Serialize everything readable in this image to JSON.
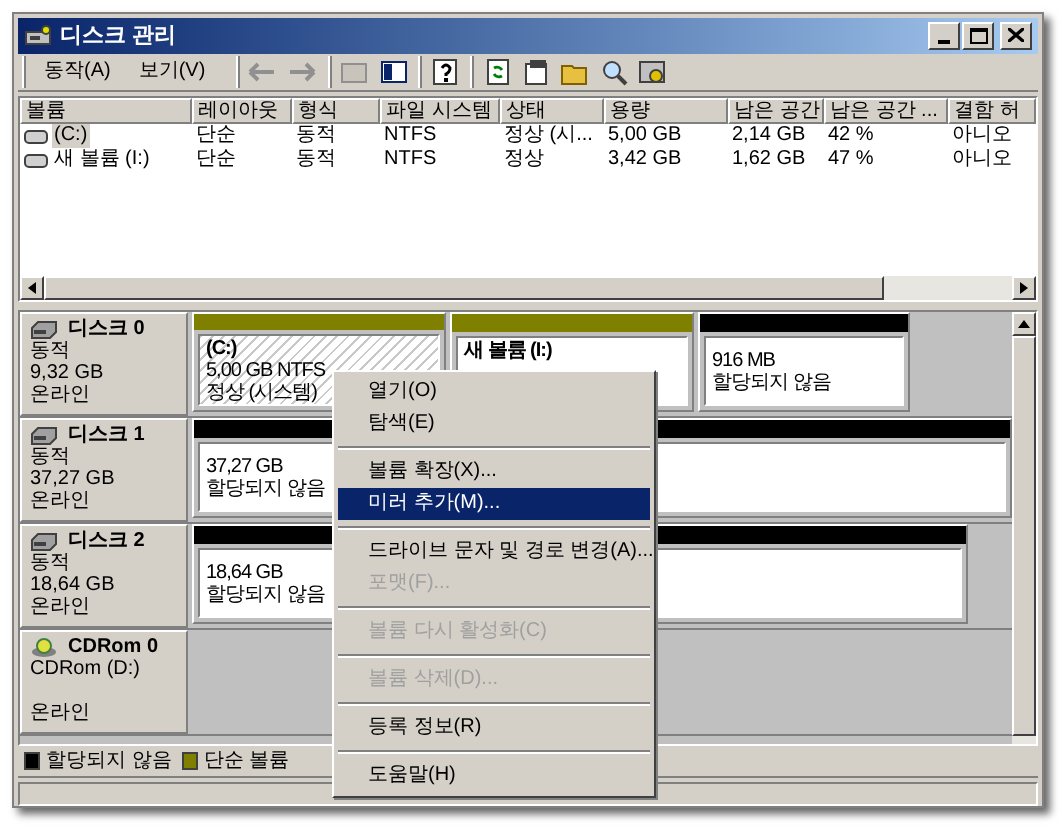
{
  "window": {
    "title": "디스크 관리"
  },
  "menu": [
    {
      "label": "동작(A)"
    },
    {
      "label": "보기(V)"
    }
  ],
  "volume_table": {
    "columns": [
      "볼륨",
      "레이아웃",
      "형식",
      "파일 시스템",
      "상태",
      "용량",
      "남은 공간",
      "남은 공간 ...",
      "결함 허"
    ],
    "rows": [
      {
        "cells": [
          "(C:)",
          "단순",
          "동적",
          "NTFS",
          "정상 (시...",
          "5,00 GB",
          "2,14 GB",
          "42 %",
          "아니오"
        ],
        "selected": true
      },
      {
        "cells": [
          "새 볼륨 (I:)",
          "단순",
          "동적",
          "NTFS",
          "정상",
          "3,42 GB",
          "1,62 GB",
          "47 %",
          "아니오"
        ],
        "selected": false
      }
    ]
  },
  "disks": [
    {
      "kind": "disk",
      "name": "디스크 0",
      "type": "동적",
      "size": "9,32 GB",
      "status": "온라인",
      "partitions": [
        {
          "kind": "simple",
          "name": "(C:)",
          "size": "5,00 GB NTFS",
          "status": "정상 (시스템)",
          "selected": true
        },
        {
          "kind": "simple",
          "name": "새 볼륨  (I:)",
          "selected": false
        },
        {
          "kind": "unallocated",
          "size": "916 MB",
          "status": "할당되지 않음",
          "selected": false
        }
      ]
    },
    {
      "kind": "disk",
      "name": "디스크 1",
      "type": "동적",
      "size": "37,27 GB",
      "status": "온라인",
      "partitions": [
        {
          "kind": "unallocated",
          "size": "37,27 GB",
          "status": "할당되지 않음",
          "selected": false
        }
      ]
    },
    {
      "kind": "disk",
      "name": "디스크 2",
      "type": "동적",
      "size": "18,64 GB",
      "status": "온라인",
      "partitions": [
        {
          "kind": "unallocated",
          "size": "18,64 GB",
          "status": "할당되지 않음",
          "selected": false
        }
      ]
    },
    {
      "kind": "cdrom",
      "name": "CDRom 0",
      "type": "CDRom (D:)",
      "status": "온라인"
    }
  ],
  "legend": [
    {
      "label": "할당되지 않음",
      "color": "#000000"
    },
    {
      "label": "단순 볼륨",
      "color": "#808000"
    }
  ],
  "context_menu": [
    {
      "kind": "item",
      "label": "열기(O)",
      "disabled": false,
      "selected": false
    },
    {
      "kind": "item",
      "label": "탐색(E)",
      "disabled": false,
      "selected": false
    },
    {
      "kind": "separator"
    },
    {
      "kind": "item",
      "label": "볼륨 확장(X)...",
      "disabled": false,
      "selected": false
    },
    {
      "kind": "item",
      "label": "미러 추가(M)...",
      "disabled": false,
      "selected": true
    },
    {
      "kind": "separator"
    },
    {
      "kind": "item",
      "label": "드라이브 문자 및 경로 변경(A)...",
      "disabled": false,
      "selected": false
    },
    {
      "kind": "item",
      "label": "포맷(F)...",
      "disabled": true,
      "selected": false
    },
    {
      "kind": "separator"
    },
    {
      "kind": "item",
      "label": "볼륨 다시 활성화(C)",
      "disabled": true,
      "selected": false
    },
    {
      "kind": "separator"
    },
    {
      "kind": "item",
      "label": "볼륨 삭제(D)...",
      "disabled": true,
      "selected": false
    },
    {
      "kind": "separator"
    },
    {
      "kind": "item",
      "label": "등록 정보(R)",
      "disabled": false,
      "selected": false
    },
    {
      "kind": "separator"
    },
    {
      "kind": "item",
      "label": "도움말(H)",
      "disabled": false,
      "selected": false
    }
  ]
}
